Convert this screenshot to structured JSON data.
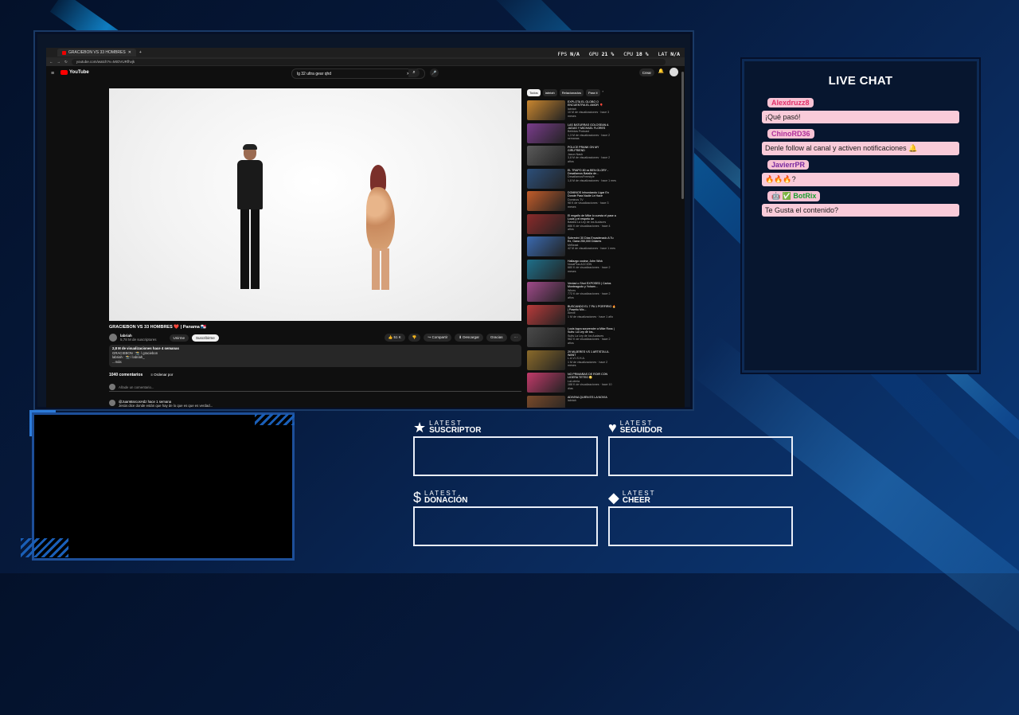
{
  "browser": {
    "tab_title": "GRACIEBON VS 33 HOMBRES",
    "url": "youtube.com/watch?v=MtOVURfhvjk",
    "perf": {
      "fps_label": "FPS",
      "fps": "N/A",
      "gpu_label": "GPU",
      "gpu": "21 %",
      "cpu_label": "CPU",
      "cpu": "18 %",
      "lat_label": "LAT",
      "lat": "N/A"
    }
  },
  "youtube": {
    "logo": "YouTube",
    "search_value": "lg 32 ultra gear qhd",
    "create_label": "Crear",
    "video_title": "GRACIEBON VS 33 HOMBRES ❤️ | Panama 🇵🇦",
    "channel": "labriah",
    "subscribers": "5,78 M de suscriptores",
    "join_label": "Unirme",
    "subscribe_label": "Suscribirme",
    "actions": [
      "👍 51 K",
      "👎",
      "↪ Compartir",
      "⬇ Descargar",
      "Gracias",
      "⋯"
    ],
    "description": {
      "line1": "2,8 M de visualizaciones  hace 4 semanas",
      "line2": "GRACIEBON : 📸 / graciebon",
      "line3": "labriah : 📸 / labriah_",
      "more": "...más"
    },
    "comments_count": "1040 comentarios",
    "sort_label": "Ordenar por",
    "add_comment_placeholder": "Añade un comentario...",
    "comment1_user": "@JuanMarcosHdz hace 1 semana",
    "comment1_text": "Jesús dice donde están que hay de lo que es que es verdad...",
    "chips": [
      "Todos",
      "labriah",
      "Relacionados",
      "Para ti",
      "›"
    ],
    "recommendations": [
      {
        "title": "EXPLOTA EL GLOBO O ENCUENTRA EL AMOR 🎈",
        "channel": "labriah",
        "meta": "10 M de visualizaciones · hace 3 meses",
        "color": "#c9862f"
      },
      {
        "title": "LAS BATURRAS GOLOSEAN A JUDAS Y MICHAEL FLORES",
        "channel": "Bebidas Podcast",
        "meta": "1,3 M de visualizaciones · hace 2 semanas",
        "color": "#7a3c8c"
      },
      {
        "title": "POLICE PRANK ON MY GIRLFRIEND",
        "channel": "Jason Nash",
        "meta": "3,8 M de visualizaciones · hace 2 años",
        "color": "#5a5a5a"
      },
      {
        "title": "EL TRAPO 80 vs BEN GLORY - Desafiamos Batalla de...",
        "channel": "DesafiamosFreestyle",
        "meta": "1,8 M de visualizaciones · hace 1 mes",
        "color": "#2c4f7a"
      },
      {
        "title": "DOMINOS Inhundando Lígar En Donde Para Nadie Le Hace",
        "channel": "Dominos TV",
        "meta": "98 K de visualizaciones · hace 3 meses",
        "color": "#c25c2a"
      },
      {
        "title": "El engaño de Mike lo cuesta el pase a Louis y el respeto de",
        "channel": "Batalla La Ley de los Audaces",
        "meta": "886 K de visualizaciones · hace 4 años",
        "color": "#8a2a2a"
      },
      {
        "title": "Sobreviví 30 Días Encadenado A Tu Ex, Gana 250,000 Dólares",
        "channel": "MrBeast",
        "meta": "42 M de visualizaciones · hace 1 mes",
        "color": "#3a6ab0"
      },
      {
        "title": "Hallazgo cocina: John Wick",
        "channel": "NocaPlus ACCIÓN",
        "meta": "680 K de visualizaciones · hace 2 meses",
        "color": "#1e6f8a"
      },
      {
        "title": "Verdad o Shot EXPOSED | Carlos Monteagudo y Yoham...",
        "channel": "Wines",
        "meta": "772 K de visualizaciones · hace 2 años",
        "color": "#a04a8a"
      },
      {
        "title": "BUSCANDO EL 7 PA 1 PORFIRIO 🔥 | Paseito Mix...",
        "channel": "Alexill",
        "meta": "1 M de visualizaciones · hace 1 año",
        "color": "#b83a3a"
      },
      {
        "title": "Louis logra sorprender a Mike Ross | Suits: La Ley de los...",
        "channel": "Suits La Ley de los Audaces",
        "meta": "962 K de visualizaciones · hace 2 años",
        "color": "#4a4a4a"
      },
      {
        "title": "29 MUJERES VS 1 ARTISTA LIL WANT",
        "channel": "L.A.V.I.S.H.A.",
        "meta": "1 M de visualizaciones · hace 2 meses",
        "color": "#8a6a2a"
      },
      {
        "title": "NO PRIMAÑAS DE ROIR CON LIGERA TETEO 😳",
        "channel": "LaLoteria",
        "meta": "188 K de visualizaciones · hace 10 días",
        "color": "#c23a6a"
      },
      {
        "title": "ADIVINA QUIEN ES LA NOVIA",
        "channel": "labriah",
        "meta": "",
        "color": "#7a4a2a"
      }
    ]
  },
  "chat": {
    "title": "LIVE CHAT",
    "messages": [
      {
        "user": "Alexdruzz8",
        "text": "¡Qué pasó!"
      },
      {
        "user": "ChinoRD36",
        "text": "Denle follow al canal y activen notificaciones 🔔"
      },
      {
        "user": "JavierrPR",
        "text": "🔥🔥🔥?"
      },
      {
        "user": "🤖 ✅ BotRix",
        "text": "Te Gusta el contenido?"
      }
    ],
    "user_colors": [
      "#e0306a",
      "#b0309a",
      "#7a2aa0",
      "#1aa030"
    ]
  },
  "latest": {
    "small_label": "LATEST",
    "suscriptor": "SUSCRIPTOR",
    "seguidor": "SEGUIDOR",
    "donacion": "DONACIÓN",
    "cheer": "CHEER"
  }
}
